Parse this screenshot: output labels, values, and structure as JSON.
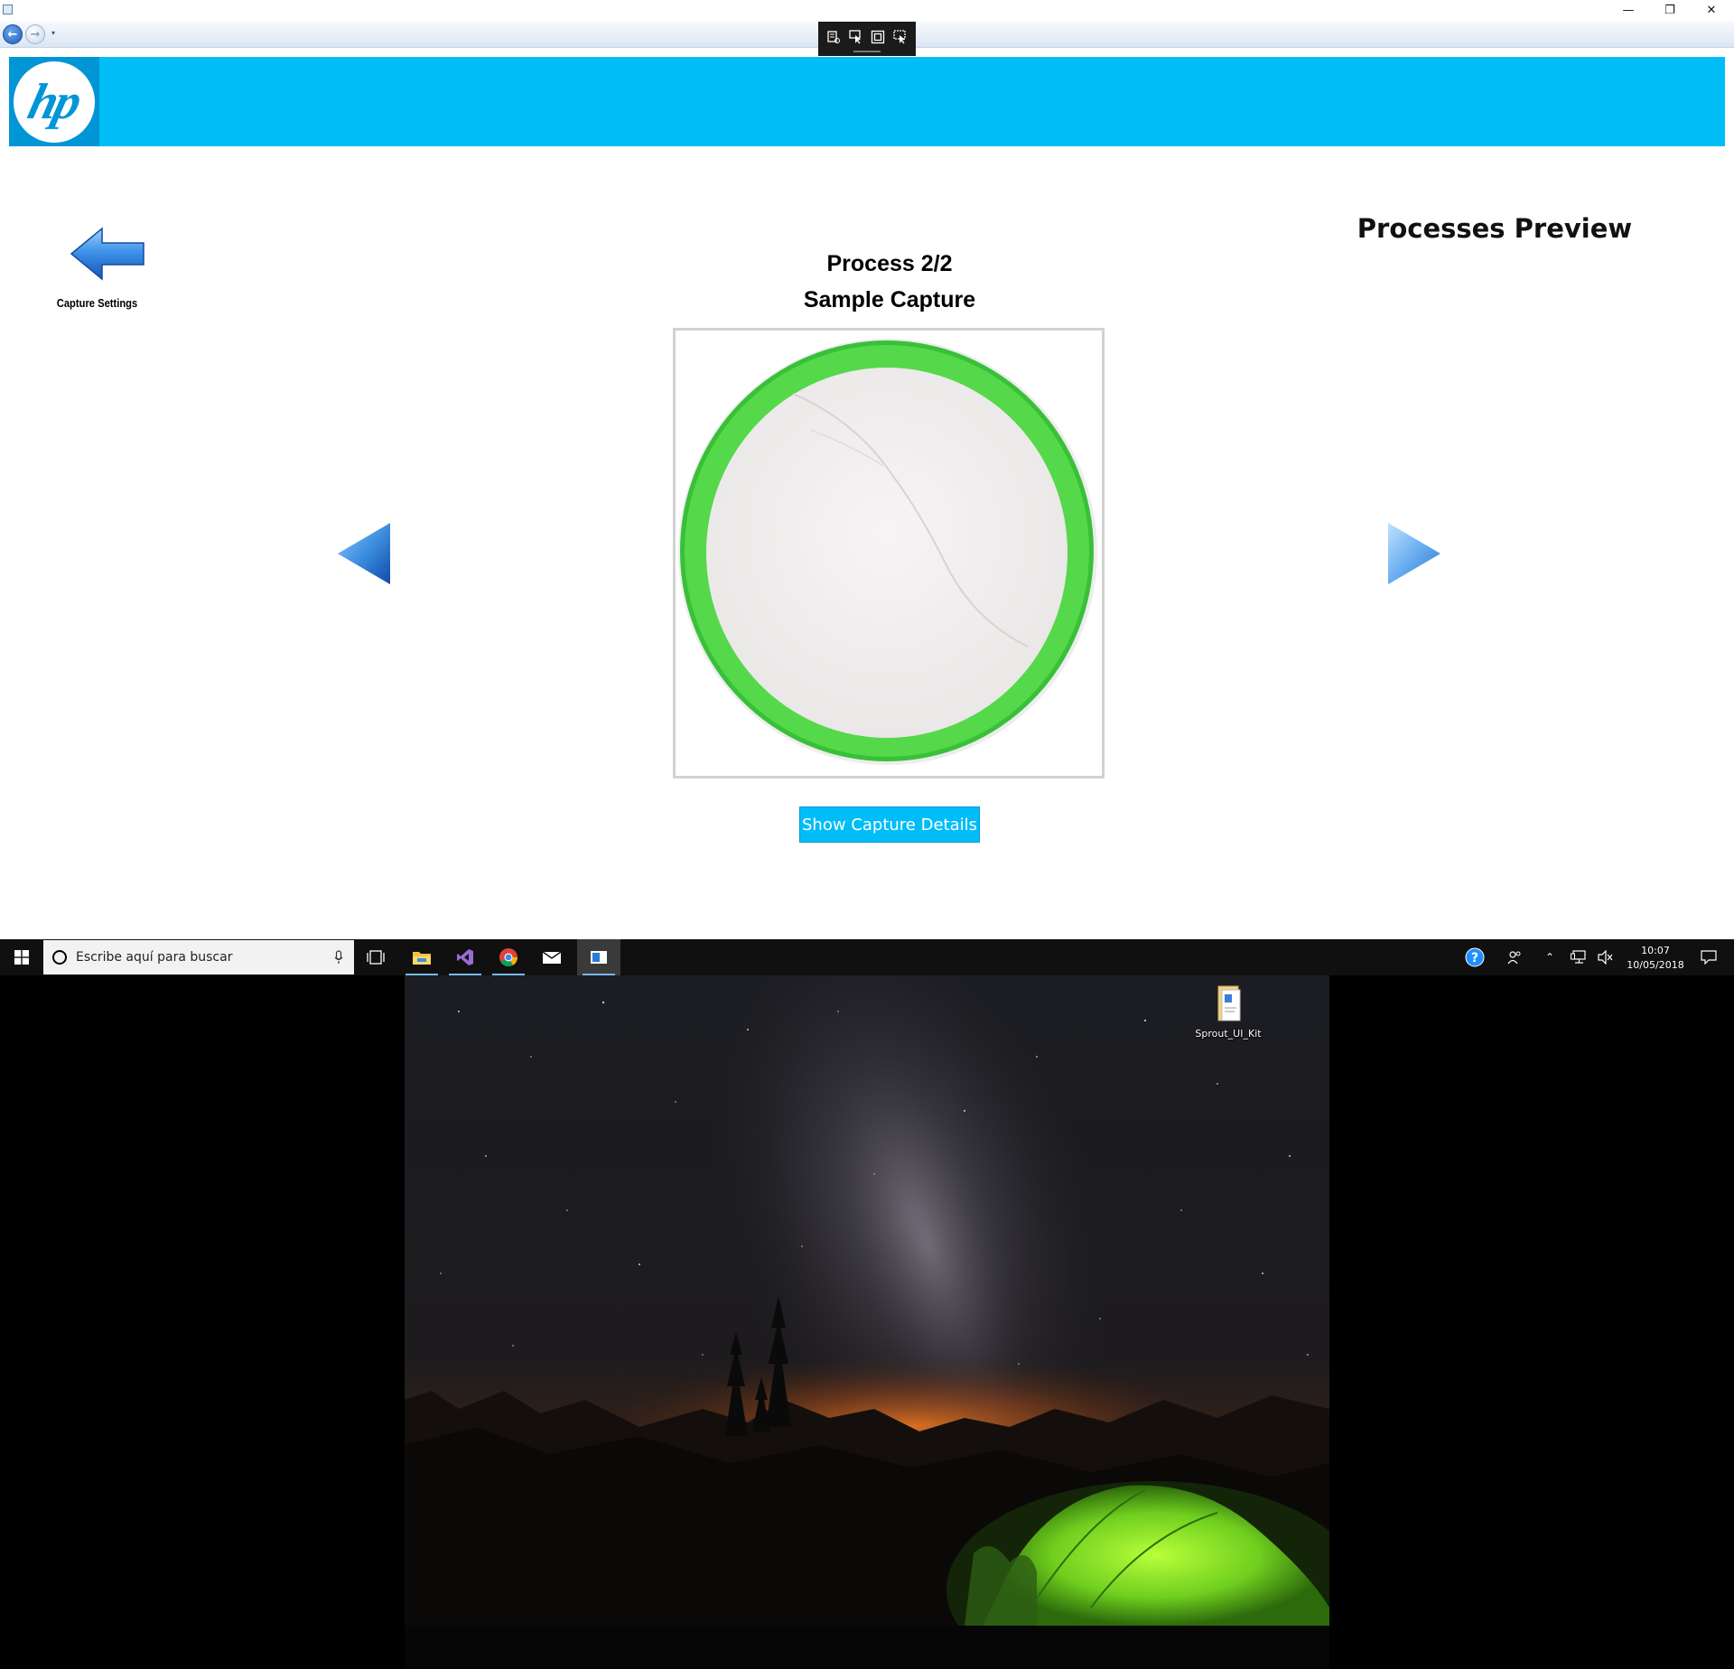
{
  "window": {
    "controls": {
      "minimize": "—",
      "restore": "❐",
      "close": "✕"
    }
  },
  "nav": {
    "back_icon": "arrow-left-icon",
    "forward_icon": "arrow-right-icon",
    "dropdown": "▾"
  },
  "debug_toolbar": {
    "icons": [
      "live-tree-icon",
      "select-element-icon",
      "display-layout-icon",
      "track-focus-icon"
    ]
  },
  "header": {
    "logo_text": "hp",
    "brand_color": "#00bdf7",
    "logo_color": "#0096d6"
  },
  "back_link": {
    "label": "Capture Settings",
    "icon": "back-arrow-icon"
  },
  "page": {
    "title": "Processes Preview",
    "process_counter": "Process 2/2",
    "process_name": "Sample Capture"
  },
  "actions": {
    "show_details": "Show Capture Details"
  },
  "taskbar": {
    "search_placeholder": "Escribe aquí para buscar",
    "apps": [
      "file-explorer-icon",
      "visual-studio-icon",
      "chrome-icon",
      "mail-icon",
      "sprout-app-icon"
    ],
    "clock_time": "10:07",
    "clock_date": "10/05/2018"
  },
  "desktop": {
    "icon_label": "Sprout_UI_Kit"
  }
}
